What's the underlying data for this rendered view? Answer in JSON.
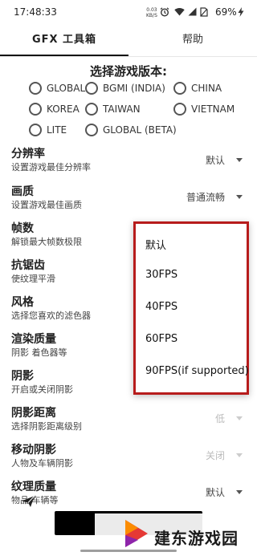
{
  "status_bar": {
    "time": "17:48:33",
    "speed_value": "0.03",
    "speed_unit": "KB/S",
    "battery": "69%",
    "icons": [
      "alarm-icon",
      "wifi-icon",
      "signal-icon",
      "no-sim-icon",
      "battery-icon",
      "charging-bolt-icon"
    ]
  },
  "tabs": [
    {
      "label": "GFX 工具箱",
      "active": true
    },
    {
      "label": "帮助",
      "active": false
    }
  ],
  "version_section": {
    "title": "选择游戏版本:",
    "options": [
      "GLOBAL",
      "BGMI (INDIA)",
      "CHINA",
      "KOREA",
      "TAIWAN",
      "VIETNAM",
      "LITE",
      "GLOBAL (BETA)"
    ]
  },
  "settings": [
    {
      "title": "分辨率",
      "desc": "设置游戏最佳分辨率",
      "value": "默认"
    },
    {
      "title": "画质",
      "desc": "设置游戏最佳画质",
      "value": "普通流畅"
    },
    {
      "title": "帧数",
      "desc": "解锁最大帧数极限",
      "value": ""
    },
    {
      "title": "抗锯齿",
      "desc": "使纹理平滑",
      "value": ""
    },
    {
      "title": "风格",
      "desc": "选择您喜欢的滤色器",
      "value": ""
    },
    {
      "title": "渲染质量",
      "desc": "阴影 着色器等",
      "value": ""
    },
    {
      "title": "阴影",
      "desc": "开启或关闭阴影",
      "value": ""
    },
    {
      "title": "阴影距离",
      "desc": "选择阴影距离级别",
      "value": "低"
    },
    {
      "title": "移动阴影",
      "desc": "人物及车辆阴影",
      "value": "关闭"
    },
    {
      "title": "纹理质量",
      "desc": "物品 车辆等",
      "value": "默认"
    }
  ],
  "fps_dropdown": {
    "options": [
      "默认",
      "30FPS",
      "40FPS",
      "60FPS",
      "90FPS(if supported)"
    ]
  },
  "bottom": {
    "send_icon": "send-icon"
  },
  "watermark": {
    "text": "建东游戏园",
    "logo_icon": "watermark-logo-icon"
  },
  "colors": {
    "popup_border": "#b71c1c",
    "tab_underline": "#111111"
  }
}
